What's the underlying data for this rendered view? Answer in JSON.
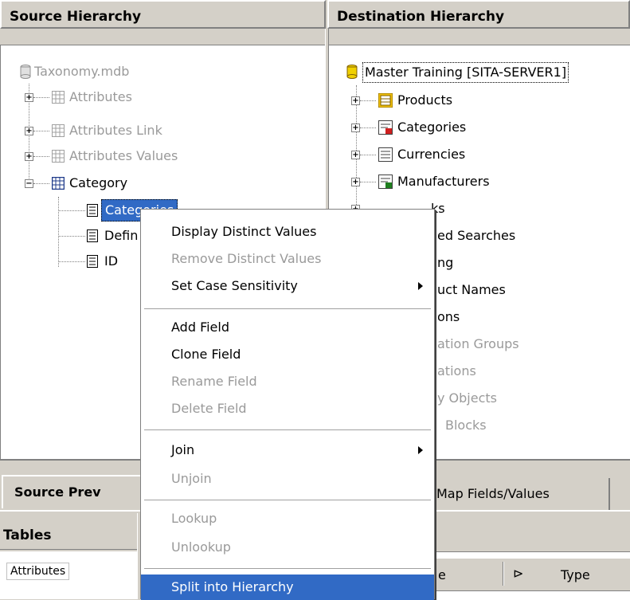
{
  "source_header": "Source Hierarchy",
  "destination_header": "Destination Hierarchy",
  "source_tree": {
    "root": "Taxonomy.mdb",
    "items": [
      {
        "label": "Attributes",
        "dim": true
      },
      {
        "label": "Attributes Link",
        "dim": true
      },
      {
        "label": "Attributes Values",
        "dim": true
      },
      {
        "label": "Category",
        "dim": false
      }
    ],
    "children": [
      "Categories",
      "Defin",
      "ID"
    ]
  },
  "destination_tree": {
    "root": "Master Training [SITA-SERVER1]",
    "items": [
      {
        "label": "Products",
        "dim": false
      },
      {
        "label": "Categories",
        "dim": false
      },
      {
        "label": "Currencies",
        "dim": false
      },
      {
        "label": "Manufacturers",
        "dim": false
      },
      {
        "label": "Masks",
        "dim": false
      },
      {
        "label": "Named Searches",
        "dim": false
      },
      {
        "label": "Pricing",
        "dim": false
      },
      {
        "label": "Product Names",
        "dim": false
      },
      {
        "label": "Relations",
        "dim": false
      },
      {
        "label": "Relation Groups",
        "dim": true
      },
      {
        "label": "Relations",
        "dim": true
      },
      {
        "label": "Library Objects",
        "dim": true
      },
      {
        "label": "Library Blocks",
        "dim": true
      }
    ],
    "visible_fragments": [
      "ks",
      "ed Searches",
      "ng",
      "uct Names",
      "ons",
      "ation Groups",
      "ations",
      "y Objects",
      "Blocks"
    ]
  },
  "context_menu": {
    "items": [
      {
        "label": "Display Distinct Values",
        "disabled": false
      },
      {
        "label": "Remove Distinct Values",
        "disabled": true
      },
      {
        "label": "Set Case Sensitivity",
        "disabled": false,
        "submenu": true
      },
      {
        "label": "Add Field",
        "disabled": false
      },
      {
        "label": "Clone Field",
        "disabled": false
      },
      {
        "label": "Rename Field",
        "disabled": true
      },
      {
        "label": "Delete Field",
        "disabled": true
      },
      {
        "label": "Join",
        "disabled": false,
        "submenu": true
      },
      {
        "label": "Unjoin",
        "disabled": true
      },
      {
        "label": "Lookup",
        "disabled": true
      },
      {
        "label": "Unlookup",
        "disabled": true
      },
      {
        "label": "Split into Hierarchy",
        "disabled": false,
        "highlighted": true
      }
    ]
  },
  "bottom": {
    "source_preview_tab": "Source Prev",
    "map_tab": "Map Fields/Values",
    "tables_header": "Tables",
    "tables_first_row": "Attributes",
    "col_partial": "e",
    "col_type": "Type"
  },
  "colors": {
    "highlight": "#316ac5",
    "dim_text": "#9a9a9a",
    "chrome": "#d4d0c8"
  }
}
